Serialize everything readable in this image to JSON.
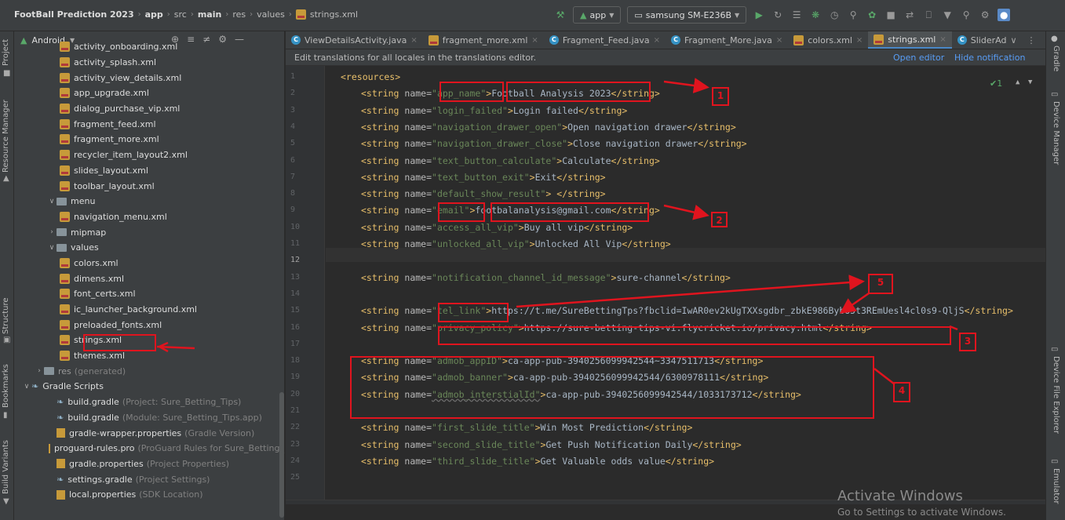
{
  "breadcrumb": [
    {
      "label": "FootBall Prediction 2023",
      "bold": true
    },
    {
      "label": "app",
      "bold": true
    },
    {
      "label": "src",
      "bold": false
    },
    {
      "label": "main",
      "bold": true
    },
    {
      "label": "res",
      "bold": false
    },
    {
      "label": "values",
      "bold": false
    },
    {
      "label": "strings.xml",
      "bold": false
    }
  ],
  "toolbar": {
    "module": "app",
    "device": "samsung SM-E236B"
  },
  "project_panel": {
    "view_mode": "Android",
    "tree": [
      {
        "label": "activity_onboarding.xml",
        "type": "xml",
        "indent": 4
      },
      {
        "label": "activity_splash.xml",
        "type": "xml",
        "indent": 4
      },
      {
        "label": "activity_view_details.xml",
        "type": "xml",
        "indent": 4
      },
      {
        "label": "app_upgrade.xml",
        "type": "xml",
        "indent": 4
      },
      {
        "label": "dialog_purchase_vip.xml",
        "type": "xml",
        "indent": 4
      },
      {
        "label": "fragment_feed.xml",
        "type": "xml",
        "indent": 4
      },
      {
        "label": "fragment_more.xml",
        "type": "xml",
        "indent": 4
      },
      {
        "label": "recycler_item_layout2.xml",
        "type": "xml",
        "indent": 4
      },
      {
        "label": "slides_layout.xml",
        "type": "xml",
        "indent": 4
      },
      {
        "label": "toolbar_layout.xml",
        "type": "xml",
        "indent": 4
      },
      {
        "label": "menu",
        "type": "folder",
        "indent": 3,
        "chev": "open"
      },
      {
        "label": "navigation_menu.xml",
        "type": "xml",
        "indent": 4
      },
      {
        "label": "mipmap",
        "type": "folder",
        "indent": 3,
        "chev": "closed"
      },
      {
        "label": "values",
        "type": "folder",
        "indent": 3,
        "chev": "open"
      },
      {
        "label": "colors.xml",
        "type": "xml",
        "indent": 4
      },
      {
        "label": "dimens.xml",
        "type": "xml",
        "indent": 4
      },
      {
        "label": "font_certs.xml",
        "type": "xml",
        "indent": 4
      },
      {
        "label": "ic_launcher_background.xml",
        "type": "xml",
        "indent": 4
      },
      {
        "label": "preloaded_fonts.xml",
        "type": "xml",
        "indent": 4
      },
      {
        "label": "strings.xml",
        "type": "xml",
        "indent": 4
      },
      {
        "label": "themes.xml",
        "type": "xml",
        "indent": 4
      },
      {
        "label": "res",
        "sub": "(generated)",
        "type": "folder",
        "indent": 2,
        "chev": "closed"
      },
      {
        "label": "Gradle Scripts",
        "type": "gradle",
        "indent": 1,
        "chev": "open"
      },
      {
        "label": "build.gradle",
        "sub": "(Project: Sure_Betting_Tips)",
        "type": "gradle",
        "indent": 3
      },
      {
        "label": "build.gradle",
        "sub": "(Module: Sure_Betting_Tips.app)",
        "type": "gradle",
        "indent": 3
      },
      {
        "label": "gradle-wrapper.properties",
        "sub": "(Gradle Version)",
        "type": "prop",
        "indent": 3
      },
      {
        "label": "proguard-rules.pro",
        "sub": "(ProGuard Rules for Sure_Betting_",
        "type": "prop",
        "indent": 3
      },
      {
        "label": "gradle.properties",
        "sub": "(Project Properties)",
        "type": "prop",
        "indent": 3
      },
      {
        "label": "settings.gradle",
        "sub": "(Project Settings)",
        "type": "gradle",
        "indent": 3
      },
      {
        "label": "local.properties",
        "sub": "(SDK Location)",
        "type": "prop",
        "indent": 3
      }
    ]
  },
  "side_tabs_left": [
    "Project",
    "Resource Manager",
    "Structure",
    "Bookmarks",
    "Build Variants"
  ],
  "side_tabs_right": [
    "Gradle",
    "Device Manager",
    "Device File Explorer",
    "Emulator"
  ],
  "editor_tabs": [
    {
      "label": "ViewDetailsActivity.java",
      "icon": "class-icon",
      "active": false
    },
    {
      "label": "fragment_more.xml",
      "icon": "xml-icon",
      "active": false
    },
    {
      "label": "Fragment_Feed.java",
      "icon": "class-icon",
      "active": false
    },
    {
      "label": "Fragment_More.java",
      "icon": "class-icon",
      "active": false
    },
    {
      "label": "colors.xml",
      "icon": "xml-icon",
      "active": false
    },
    {
      "label": "strings.xml",
      "icon": "xml-icon",
      "active": true
    },
    {
      "label": "SliderAd",
      "icon": "class-icon",
      "active": false
    }
  ],
  "notification": {
    "text": "Edit translations for all locales in the translations editor.",
    "open_editor": "Open editor",
    "hide": "Hide notification"
  },
  "inspection": "✔1",
  "code_lines": [
    {
      "n": "1",
      "html": "<span class='tag'>&lt;resources&gt;</span>"
    },
    {
      "n": "2",
      "name": "app_name",
      "value": "Football Analysis 2023"
    },
    {
      "n": "3",
      "name": "login_failed",
      "value": "Login failed"
    },
    {
      "n": "4",
      "name": "navigation_drawer_open",
      "value": "Open navigation drawer"
    },
    {
      "n": "5",
      "name": "navigation_drawer_close",
      "value": "Close navigation drawer"
    },
    {
      "n": "6",
      "name": "text_button_calculate",
      "value": "Calculate"
    },
    {
      "n": "7",
      "name": "text_button_exit",
      "value": "Exit"
    },
    {
      "n": "8",
      "name": "default_show_result",
      "value": " "
    },
    {
      "n": "9",
      "name": "email",
      "value": "footbalanalysis@gmail.com"
    },
    {
      "n": "10",
      "name": "access_all_vip",
      "value": "Buy all vip"
    },
    {
      "n": "11",
      "name": "unlocked_all_vip",
      "value": "Unlocked All Vip"
    },
    {
      "n": "12"
    },
    {
      "n": "13",
      "name": "notification_channel_id_message",
      "value": "sure-channel"
    },
    {
      "n": "14"
    },
    {
      "n": "15",
      "name": "tel_link",
      "value": "https://t.me/SureBettingTps?fbclid=IwAR0ev2kUgTXXsgdbr_zbkE986BybU5t3REmUesl4cl0s9-QljS"
    },
    {
      "n": "16",
      "name": "privacy_policy",
      "value": "https://sure-betting-tips-vi.flycricket.io/privacy.html"
    },
    {
      "n": "17"
    },
    {
      "n": "18",
      "name": "admob_appID",
      "value": "ca-app-pub-3940256099942544~3347511713"
    },
    {
      "n": "19",
      "name": "admob_banner",
      "value": "ca-app-pub-3940256099942544/6300978111"
    },
    {
      "n": "20",
      "name": "admob_interstialId",
      "value": "ca-app-pub-3940256099942544/1033173712"
    },
    {
      "n": "21"
    },
    {
      "n": "22",
      "name": "first_slide_title",
      "value": "Win Most Prediction"
    },
    {
      "n": "23",
      "name": "second_slide_title",
      "value": "Get Push Notification Daily"
    },
    {
      "n": "24",
      "name": "third_slide_title",
      "value": "Get Valuable odds value"
    },
    {
      "n": "25"
    }
  ],
  "bottom_breadcrumb": "resources",
  "annotation_numbers": [
    "1",
    "2",
    "3",
    "4",
    "5"
  ],
  "watermark": {
    "title": "Activate Windows",
    "subtitle": "Go to Settings to activate Windows."
  },
  "colors": {
    "annotation": "#e0141e",
    "tag": "#e8bf6a",
    "string": "#6a8759",
    "link": "#589df6"
  }
}
